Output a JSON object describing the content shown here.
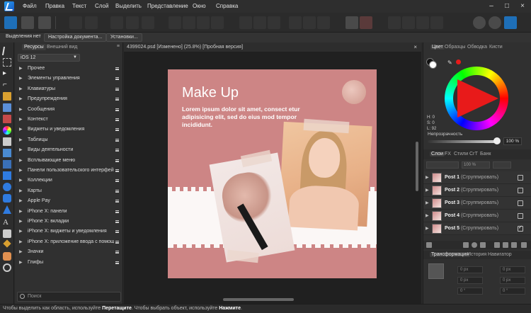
{
  "menu": {
    "items": [
      "Файл",
      "Правка",
      "Текст",
      "Слой",
      "Выделить",
      "Представление",
      "Окно",
      "Справка"
    ]
  },
  "context_bar": {
    "buttons": [
      "Выделения нет",
      "Настройка документа...",
      "Установки..."
    ]
  },
  "left_panel": {
    "tabs": [
      "Ресурсы",
      "Внешний вид"
    ],
    "ios_select": "iOS 12",
    "items": [
      "Прочее",
      "Элементы управления",
      "Клавиатуры",
      "Предупреждения",
      "Сообщения",
      "Контекст",
      "Виджеты и уведомления",
      "Таблицы",
      "Виды деятельности",
      "Всплывающие меню",
      "Панели пользовательского интерфейса",
      "Коллекции",
      "Карты",
      "Apple Pay",
      "iPhone X: панели",
      "iPhone X: вкладки",
      "iPhone X: виджеты и уведомления",
      "iPhone X: приложение ввода с помощью",
      "Значки",
      "Глифы"
    ],
    "search_placeholder": "Поиск"
  },
  "document": {
    "tab_title": "4399024.psd [Изменено] (25.8%) [Пробная версия]",
    "close": "×",
    "artwork": {
      "title": "Make Up",
      "body": "Lorem ipsum dolor sit amet, consect etur adipisicing elit, sed do eius mod tempor incididunt."
    }
  },
  "right_panel": {
    "color_tabs": [
      "Цвет",
      "Образцы",
      "Обводка",
      "Кисти"
    ],
    "hsl": {
      "h": "H: 0",
      "s": "S: 0",
      "l": "L: 92"
    },
    "opacity_label": "Непрозрачность",
    "opacity_value": "100 %",
    "layer_tabs": [
      "Слои",
      "FX",
      "Стили",
      "СгТ",
      "Банк"
    ],
    "layer_opacity": "100 %",
    "layers": [
      {
        "name": "Post 1",
        "type": "(Сгруппировать)",
        "visible": false
      },
      {
        "name": "Post 2",
        "type": "(Сгруппировать)",
        "visible": false
      },
      {
        "name": "Post 3",
        "type": "(Сгруппировать)",
        "visible": false
      },
      {
        "name": "Post 4",
        "type": "(Сгруппировать)",
        "visible": false
      },
      {
        "name": "Post 5",
        "type": "(Сгруппировать)",
        "visible": true
      }
    ],
    "transform_tabs": [
      "Трансформация",
      "История",
      "Навигатор"
    ],
    "transform_fields": [
      "0 px",
      "0 px",
      "0 px",
      "0 px",
      "0 °",
      "0 °"
    ]
  },
  "status": {
    "pre1": "Чтобы выделить как область, используйте ",
    "bold1": "Перетащите",
    "pre2": ". Чтобы выбрать объект, используйте ",
    "bold2": "Нажмите",
    "end": "."
  },
  "colors": {
    "accent_blue": "#1e88e5",
    "artwork_bg": "#cd8585",
    "primary_color": "#e81a1a"
  }
}
